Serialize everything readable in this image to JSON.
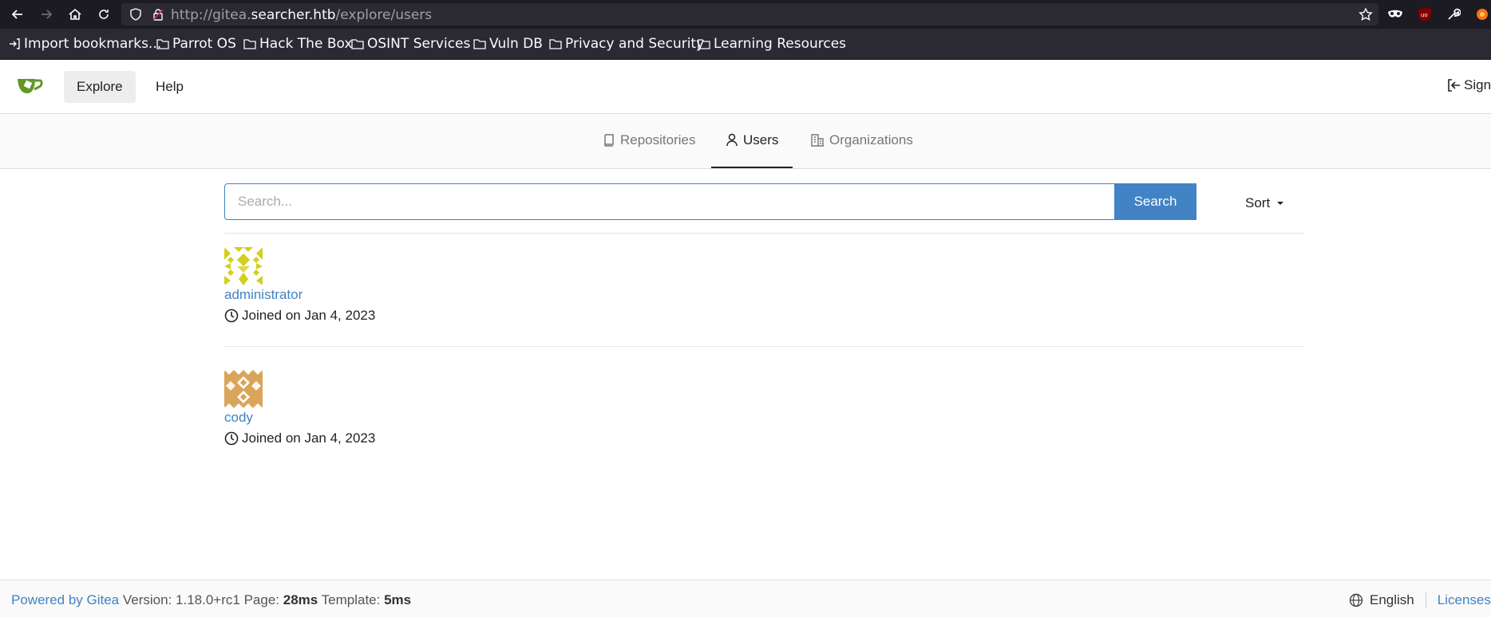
{
  "browser": {
    "url_prefix": "http://gitea.",
    "url_host": "searcher.htb",
    "url_path": "/explore/users",
    "bookmarks": [
      "Import bookmarks...",
      "Parrot OS",
      "Hack The Box",
      "OSINT Services",
      "Vuln DB",
      "Privacy and Security",
      "Learning Resources"
    ]
  },
  "navbar": {
    "explore_label": "Explore",
    "help_label": "Help",
    "signin_label": "Sign"
  },
  "tabs": [
    {
      "label": "Repositories",
      "icon": "repo-icon"
    },
    {
      "label": "Users",
      "icon": "person-icon"
    },
    {
      "label": "Organizations",
      "icon": "organization-icon"
    }
  ],
  "search": {
    "placeholder": "Search...",
    "button_label": "Search",
    "sort_label": "Sort"
  },
  "users": [
    {
      "name": "administrator",
      "joined": "Joined on Jan 4, 2023",
      "avatar_color": "#d4cf1e"
    },
    {
      "name": "cody",
      "joined": "Joined on Jan 4, 2023",
      "avatar_color": "#d9a55a"
    }
  ],
  "footer": {
    "powered_by": "Powered by Gitea",
    "version": "Version: 1.18.0+rc1",
    "page_label": "Page:",
    "page_time": "28ms",
    "template_label": "Template:",
    "template_time": "5ms",
    "language": "English",
    "licenses": "Licenses"
  },
  "colors": {
    "accent": "#4183c4",
    "gitea_green": "#609926"
  }
}
